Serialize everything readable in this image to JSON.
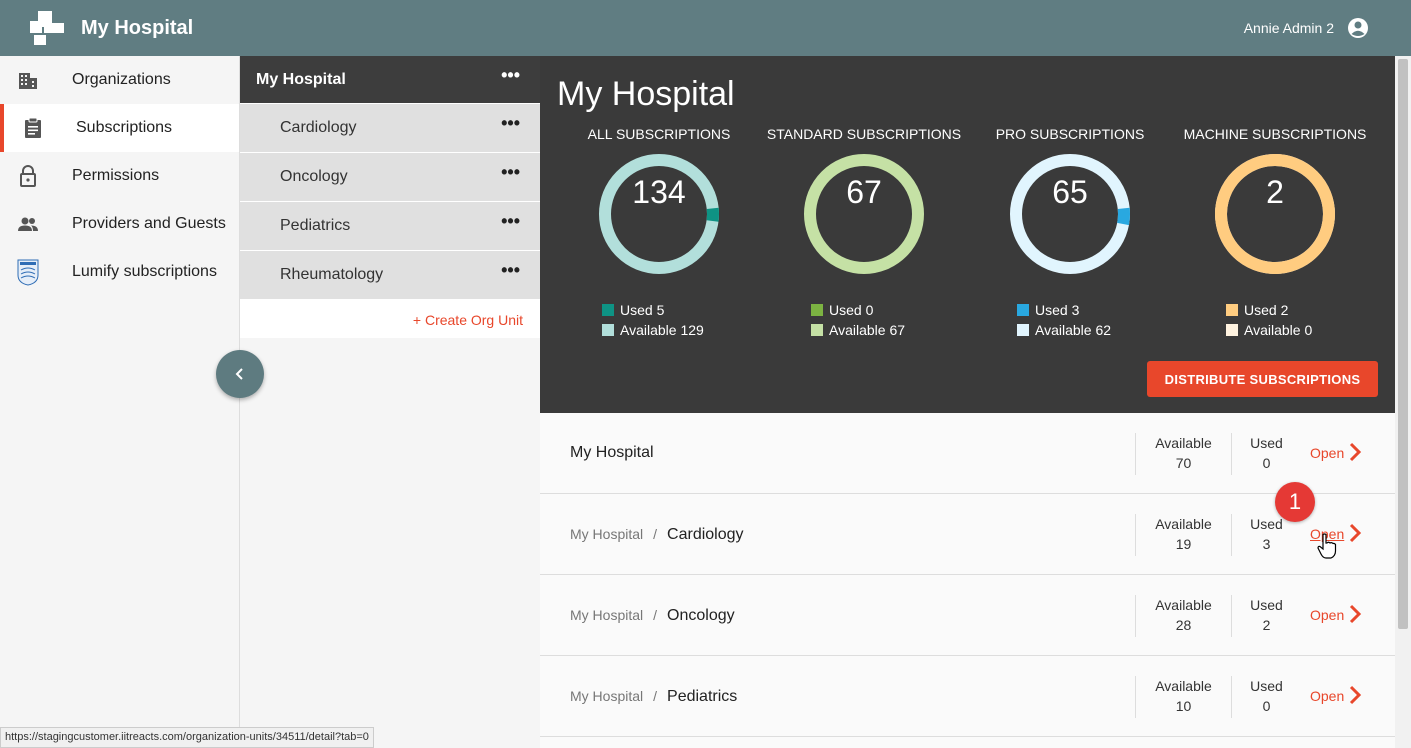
{
  "app": {
    "title": "My Hospital",
    "logo_icon": "brand-logo-icon",
    "user_name": "Annie Admin 2",
    "user_icon": "account-circle-icon"
  },
  "nav": {
    "items": [
      {
        "label": "Organizations",
        "icon": "building-icon",
        "active": false
      },
      {
        "label": "Subscriptions",
        "icon": "clipboard-icon",
        "active": true
      },
      {
        "label": "Permissions",
        "icon": "lock-icon",
        "active": false
      },
      {
        "label": "Providers and Guests",
        "icon": "people-icon",
        "active": false
      },
      {
        "label": "Lumify subscriptions",
        "icon": "philips-shield-icon",
        "active": false
      }
    ],
    "collapse_icon": "chevron-left-icon"
  },
  "orgtree": {
    "root": "My Hospital",
    "units": [
      "Cardiology",
      "Oncology",
      "Pediatrics",
      "Rheumatology"
    ],
    "more": "•••",
    "create_label": "+ Create Org Unit"
  },
  "dashboard": {
    "title": "My Hospital",
    "stats": [
      {
        "title": "ALL SUBSCRIPTIONS",
        "total": "134",
        "used": 5,
        "available": 129,
        "used_label": "Used 5",
        "avail_label": "Available 129",
        "used_color": "#0e9384",
        "avail_color": "#b2dfdb"
      },
      {
        "title": "STANDARD SUBSCRIPTIONS",
        "total": "67",
        "used": 0,
        "available": 67,
        "used_label": "Used 0",
        "avail_label": "Available 67",
        "used_color": "#7cb342",
        "avail_color": "#c5e1a5"
      },
      {
        "title": "PRO SUBSCRIPTIONS",
        "total": "65",
        "used": 3,
        "available": 62,
        "used_label": "Used 3",
        "avail_label": "Available 62",
        "used_color": "#29a8e0",
        "avail_color": "#e1f5fe"
      },
      {
        "title": "MACHINE SUBSCRIPTIONS",
        "total": "2",
        "used": 2,
        "available": 0,
        "used_label": "Used 2",
        "avail_label": "Available 0",
        "used_color": "#ffcc80",
        "avail_color": "#fff3e0"
      }
    ],
    "distribute_label": "DISTRIBUTE SUBSCRIPTIONS"
  },
  "list": {
    "sep": "/",
    "avail_header": "Available",
    "used_header": "Used",
    "open_label": "Open",
    "rows": [
      {
        "parent": "",
        "name": "My Hospital",
        "available": "70",
        "used": "0"
      },
      {
        "parent": "My Hospital",
        "name": "Cardiology",
        "available": "19",
        "used": "3"
      },
      {
        "parent": "My Hospital",
        "name": "Oncology",
        "available": "28",
        "used": "2"
      },
      {
        "parent": "My Hospital",
        "name": "Pediatrics",
        "available": "10",
        "used": "0"
      }
    ]
  },
  "annotation": {
    "step": "1"
  },
  "status_url": "https://stagingcustomer.iitreacts.com/organization-units/34511/detail?tab=0"
}
